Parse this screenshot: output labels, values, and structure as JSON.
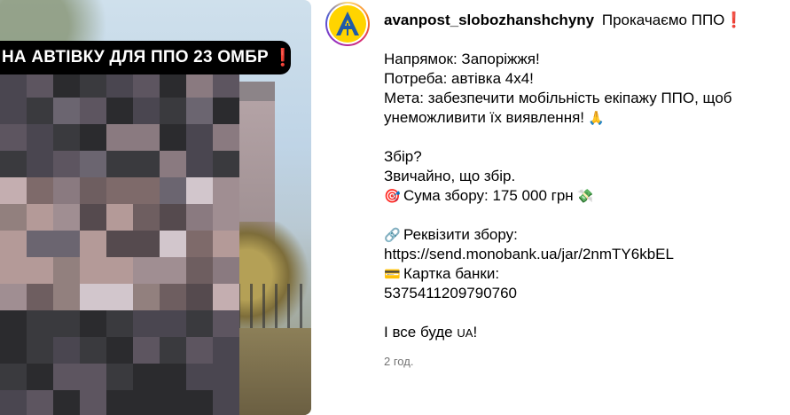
{
  "media": {
    "caption": "НА АВТІВКУ ДЛЯ ППО 23 ОМБР",
    "caption_mark": "❗"
  },
  "post": {
    "username": "avanpost_slobozhanshchyny",
    "title_text": "Прокачаємо ППО",
    "title_mark": "❗",
    "lines": {
      "direction": "Напрямок: Запоріжжя!",
      "need": "Потреба: автівка 4х4!",
      "goal_1": "Мета: забезпечити мобільність екіпажу ППО, щоб",
      "goal_2": "унеможливити їх виявлення!",
      "fundraising_q": "Збір?",
      "of_course": "Звичайно, що збір.",
      "sum": "Сума збору: 175 000 грн",
      "requisites": "Реквізити збору:",
      "link": "https://send.monobank.ua/jar/2nmTY6kbEL",
      "card_label": "Картка банки:",
      "card_number": "5375411209790760",
      "closing_prefix": "І все буде ",
      "closing_ua": "UA",
      "closing_suffix": "!"
    },
    "icons": {
      "pray": "🙏",
      "target": "🎯",
      "money": "💸",
      "link": "🔗",
      "card": "💳"
    },
    "timestamp": "2 год."
  },
  "colors": {
    "accent_red": "#d21f26",
    "muted": "#737373",
    "logo_yellow": "#ffd400",
    "logo_blue": "#1f5aa8"
  }
}
